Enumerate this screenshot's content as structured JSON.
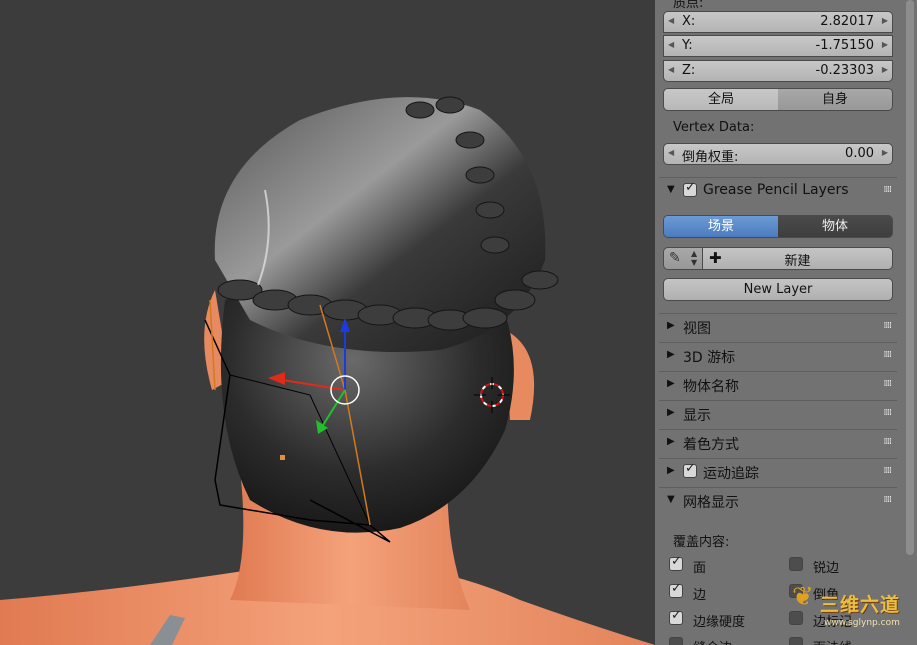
{
  "panel": {
    "transform_title": "质点:",
    "x": {
      "label": "X:",
      "value": "2.82017"
    },
    "y": {
      "label": "Y:",
      "value": "-1.75150"
    },
    "z": {
      "label": "Z:",
      "value": "-0.23303"
    },
    "space_global": "全局",
    "space_local": "自身",
    "vertex_data_label": "Vertex Data:",
    "bevel_weight": {
      "label": "倒角权重:",
      "value": "0.00"
    },
    "grease_pencil": {
      "title": "Grease Pencil Layers",
      "tab_scene": "场景",
      "tab_object": "物体",
      "new_label": "新建",
      "new_layer": "New Layer"
    },
    "sections": [
      {
        "label": "视图"
      },
      {
        "label": "3D 游标"
      },
      {
        "label": "物体名称"
      },
      {
        "label": "显示"
      },
      {
        "label": "着色方式"
      },
      {
        "label": "运动追踪"
      },
      {
        "label": "网格显示"
      }
    ],
    "overlay_label": "覆盖内容:",
    "checks_left": [
      {
        "label": "面"
      },
      {
        "label": "边"
      },
      {
        "label": "边缘硬度"
      },
      {
        "label": "缝合边"
      }
    ],
    "checks_right": [
      {
        "label": "锐边"
      },
      {
        "label": "倒角"
      },
      {
        "label": "边标记"
      },
      {
        "label": "面法线"
      }
    ]
  },
  "watermark": {
    "text": "三维六道",
    "url": "www.sglynp.com"
  }
}
